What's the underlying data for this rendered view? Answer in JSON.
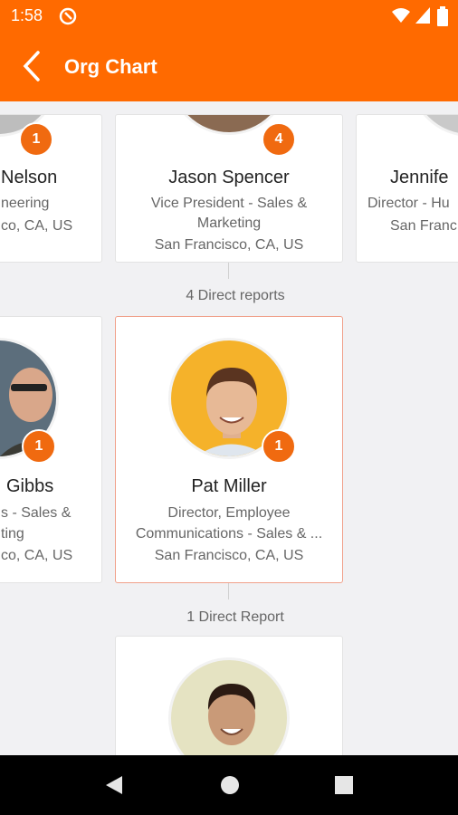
{
  "status": {
    "time": "1:58"
  },
  "appbar": {
    "title": "Org Chart"
  },
  "top_row": [
    {
      "name": "Nelson",
      "line1": "neering",
      "line2": "co, CA, US",
      "badge": "1"
    },
    {
      "name": "Jason Spencer",
      "line1": "Vice President - Sales &",
      "line2": "Marketing",
      "line3": "San Francisco, CA, US",
      "badge": "4"
    },
    {
      "name": "Jennife",
      "line1": "Director - Hu",
      "line2": "San Franc"
    }
  ],
  "reports_label_1": "4 Direct reports",
  "middle_row": [
    {
      "name": "Gibbs",
      "line1": "s - Sales &",
      "line2": "ting",
      "line3": "co, CA, US",
      "badge": "1"
    },
    {
      "name": "Pat Miller",
      "line1": "Director, Employee",
      "line2": "Communications - Sales & ...",
      "line3": "San Francisco, CA, US",
      "badge": "1"
    }
  ],
  "reports_label_2": "1 Direct Report",
  "colors": {
    "accent": "#ff6a00",
    "badge": "#f06a10"
  },
  "icons": [
    "notification-icon",
    "wifi-icon",
    "signal-icon",
    "battery-icon",
    "back-arrow-icon",
    "nav-back-icon",
    "nav-home-icon",
    "nav-recents-icon"
  ]
}
